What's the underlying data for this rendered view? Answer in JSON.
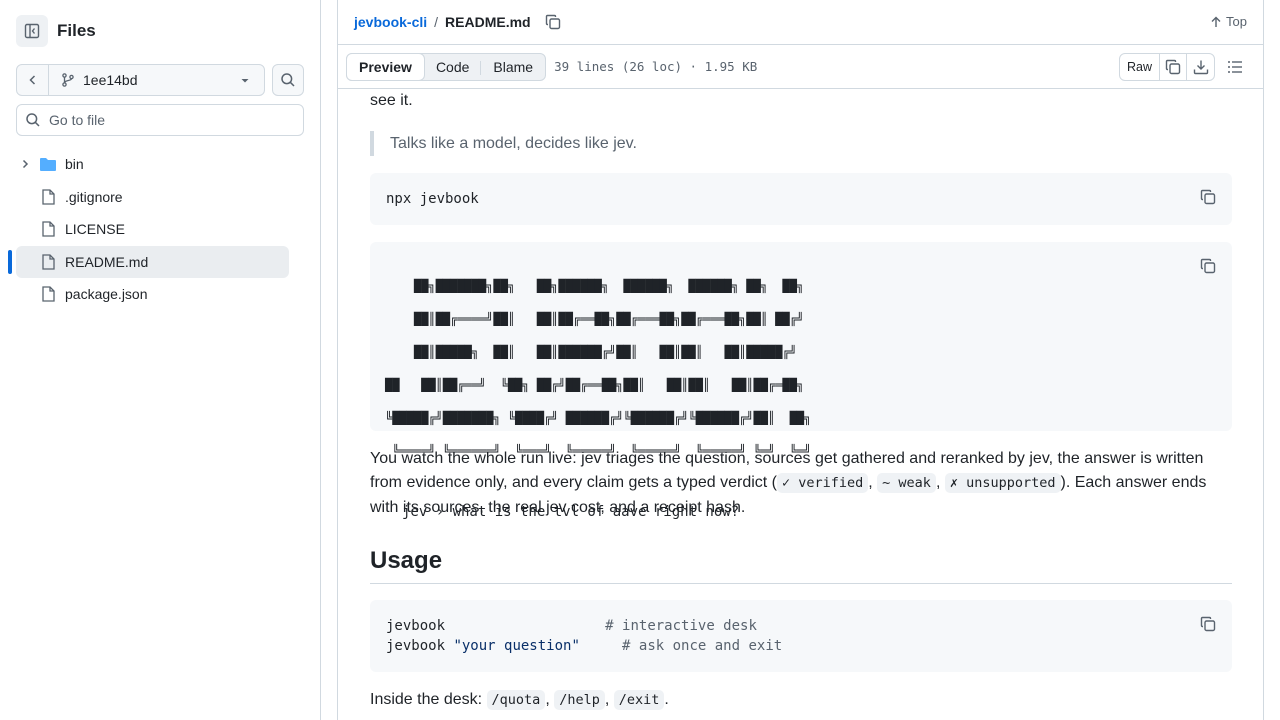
{
  "sidebar": {
    "title": "Files",
    "branch": "1ee14bd",
    "search_placeholder": "Go to file",
    "items": [
      {
        "label": "bin",
        "type": "folder"
      },
      {
        "label": ".gitignore",
        "type": "file"
      },
      {
        "label": "LICENSE",
        "type": "file"
      },
      {
        "label": "README.md",
        "type": "file",
        "selected": true
      },
      {
        "label": "package.json",
        "type": "file"
      }
    ]
  },
  "header": {
    "repo": "jevbook-cli",
    "separator": "/",
    "file": "README.md",
    "top_label": "Top"
  },
  "filebar": {
    "tabs": [
      "Preview",
      "Code",
      "Blame"
    ],
    "info": "39 lines (26 loc) · 1.95 KB",
    "raw_label": "Raw"
  },
  "readme": {
    "intro_tail": "see it.",
    "quote": "Talks like a model, decides like jev.",
    "install_cmd": "npx jevbook",
    "banner_lines": [
      "    ██╗███████╗██╗   ██╗██████╗  ██████╗  ██████╗ ██╗  ██╗",
      "    ██║██╔════╝██║   ██║██╔══██╗██╔═══██╗██╔═══██╗██║ ██╔╝",
      "    ██║█████╗  ██║   ██║██████╔╝██║   ██║██║   ██║█████╔╝ ",
      "██   ██║██╔══╝  ╚██╗ ██╔╝██╔══██╗██║   ██║██║   ██║██╔═██╗ ",
      "╚█████╔╝███████╗ ╚████╔╝ ██████╔╝╚██████╔╝╚██████╔╝██║  ██╗",
      " ╚════╝ ╚══════╝  ╚═══╝  ╚═════╝  ╚═════╝  ╚═════╝ ╚═╝  ╚═╝"
    ],
    "prompt_line": "jev › what is the tvl of aave right now?",
    "para1_a": "You watch the whole run live: jev triages the question, sources get gathered and reranked by jev, the answer is written from evidence only, and every claim gets a typed verdict (",
    "verdict_verified": "✓ verified",
    "verdict_weak": "~ weak",
    "verdict_unsupported": "✗ unsupported",
    "para1_b": "). Each answer ends with its sources, the real jev cost, and a receipt hash.",
    "usage_heading": "Usage",
    "usage_lines": [
      {
        "cmd": "jevbook",
        "arg": "",
        "pad": "                   ",
        "comment": "# interactive desk"
      },
      {
        "cmd": "jevbook ",
        "arg": "\"your question\"",
        "pad": "     ",
        "comment": "# ask once and exit"
      }
    ],
    "desk_prefix": "Inside the desk:",
    "desk_cmds": [
      "/quota",
      "/help",
      "/exit"
    ]
  }
}
